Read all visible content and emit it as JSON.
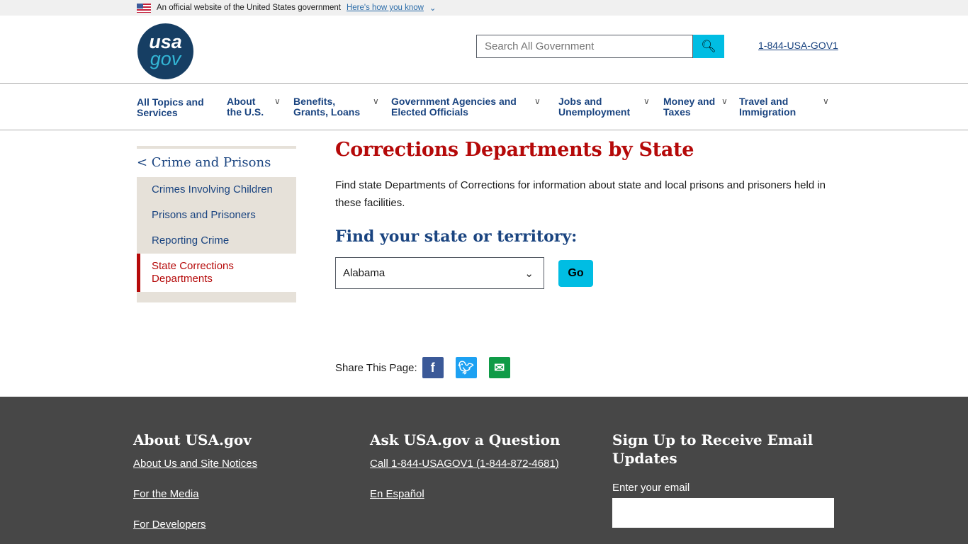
{
  "banner": {
    "text": "An official website of the United States government",
    "link": "Here's how you know"
  },
  "header": {
    "logo_top": "usa",
    "logo_bottom": "gov",
    "search_placeholder": "Search All Government",
    "phone": "1-844-USA-GOV1"
  },
  "nav": [
    "All Topics and Services",
    "About the U.S.",
    "Benefits, Grants, Loans",
    "Government Agencies and Elected Officials",
    "Jobs and Unemployment",
    "Money and Taxes",
    "Travel and Immigration"
  ],
  "sidebar": {
    "back": "< Crime and Prisons",
    "items": [
      "Crimes Involving Children",
      "Prisons and Prisoners",
      "Reporting Crime",
      "State Corrections Departments"
    ]
  },
  "main": {
    "title": "Corrections Departments by State",
    "description": "Find state Departments of Corrections for information about state and local prisons and prisoners held in these facilities.",
    "subtitle": "Find your state or territory:",
    "selected_state": "Alabama",
    "go": "Go"
  },
  "share": {
    "label": "Share This Page:"
  },
  "footer": {
    "about_title": "About USA.gov",
    "about_links": [
      "About Us and Site Notices",
      "For the Media",
      "For Developers"
    ],
    "ask_title": "Ask USA.gov a Question",
    "ask_links": [
      "Call 1-844-USAGOV1 (1-844-872-4681)",
      "En Español"
    ],
    "signup_title": "Sign Up to Receive Email Updates",
    "email_label": "Enter your email"
  },
  "colors": {
    "accent": "#00bde3",
    "title_red": "#b50909",
    "navy": "#1a4480",
    "footer_bg": "#474747"
  }
}
